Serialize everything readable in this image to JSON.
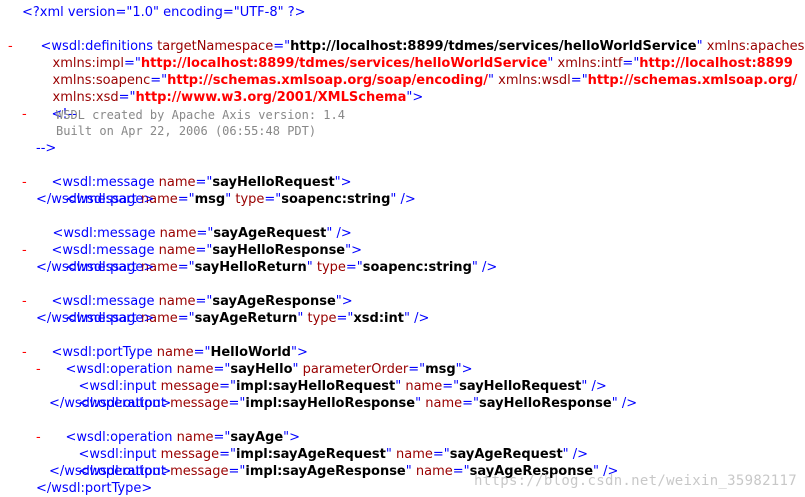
{
  "xml_decl": "<?xml version=\"1.0\" encoding=\"UTF-8\" ?>",
  "toggle_glyph": "-",
  "lines": {
    "l2": {
      "tag": "<wsdl:definitions ",
      "a1": "targetNamespace",
      "eq1": "=\"",
      "v1": "http://localhost:8899/tdmes/services/helloWorldService",
      "q1": "\"",
      "a2": " xmlns:apachesoap"
    },
    "l3": {
      "a1": "xmlns:impl",
      "eq1": "=\"",
      "v1": "http://localhost:8899/tdmes/services/helloWorldService",
      "q1": "\"",
      "a2": " xmlns:intf",
      "eq2": "=\"",
      "v2": "http://localhost:8899"
    },
    "l4": {
      "a1": "xmlns:soapenc",
      "eq1": "=\"",
      "v1": "http://schemas.xmlsoap.org/soap/encoding/",
      "q1": "\"",
      "a2": " xmlns:wsdl",
      "eq2": "=\"",
      "v2": "http://schemas.xmlsoap.org/"
    },
    "l5": {
      "a1": "xmlns:xsd",
      "eq1": "=\"",
      "v1": "http://www.w3.org/2001/XMLSchema",
      "close": "\">"
    },
    "l6": {
      "text": "<!--"
    },
    "l7": {
      "text": "WSDL created by Apache Axis version: 1.4"
    },
    "l8": {
      "text": "Built on Apr 22, 2006 (06:55:48 PDT)"
    },
    "l9": {
      "text": "-->"
    },
    "l10": {
      "open": "<wsdl:message ",
      "a1": "name",
      "eq": "=\"",
      "v1": "sayHelloRequest",
      "close": "\">"
    },
    "l11": {
      "open": "<wsdl:part ",
      "a1": "name",
      "eq1": "=\"",
      "v1": "msg",
      "q1": "\" ",
      "a2": "type",
      "eq2": "=\"",
      "v2": "soapenc:string",
      "close": "\" />"
    },
    "l12": {
      "text": "</wsdl:message>"
    },
    "l13": {
      "open": "<wsdl:message ",
      "a1": "name",
      "eq": "=\"",
      "v1": "sayAgeRequest",
      "close": "\" />"
    },
    "l14": {
      "open": "<wsdl:message ",
      "a1": "name",
      "eq": "=\"",
      "v1": "sayHelloResponse",
      "close": "\">"
    },
    "l15": {
      "open": "<wsdl:part ",
      "a1": "name",
      "eq1": "=\"",
      "v1": "sayHelloReturn",
      "q1": "\" ",
      "a2": "type",
      "eq2": "=\"",
      "v2": "soapenc:string",
      "close": "\" />"
    },
    "l16": {
      "text": "</wsdl:message>"
    },
    "l17": {
      "open": "<wsdl:message ",
      "a1": "name",
      "eq": "=\"",
      "v1": "sayAgeResponse",
      "close": "\">"
    },
    "l18": {
      "open": "<wsdl:part ",
      "a1": "name",
      "eq1": "=\"",
      "v1": "sayAgeReturn",
      "q1": "\" ",
      "a2": "type",
      "eq2": "=\"",
      "v2": "xsd:int",
      "close": "\" />"
    },
    "l19": {
      "text": "</wsdl:message>"
    },
    "l20": {
      "open": "<wsdl:portType ",
      "a1": "name",
      "eq": "=\"",
      "v1": "HelloWorld",
      "close": "\">"
    },
    "l21": {
      "open": "<wsdl:operation ",
      "a1": "name",
      "eq1": "=\"",
      "v1": "sayHello",
      "q1": "\" ",
      "a2": "parameterOrder",
      "eq2": "=\"",
      "v2": "msg",
      "close": "\">"
    },
    "l22": {
      "open": "<wsdl:input ",
      "a1": "message",
      "eq1": "=\"",
      "v1": "impl:sayHelloRequest",
      "q1": "\" ",
      "a2": "name",
      "eq2": "=\"",
      "v2": "sayHelloRequest",
      "close": "\" />"
    },
    "l23": {
      "open": "<wsdl:output ",
      "a1": "message",
      "eq1": "=\"",
      "v1": "impl:sayHelloResponse",
      "q1": "\" ",
      "a2": "name",
      "eq2": "=\"",
      "v2": "sayHelloResponse",
      "close": "\" />"
    },
    "l24": {
      "text": "</wsdl:operation>"
    },
    "l25": {
      "open": "<wsdl:operation ",
      "a1": "name",
      "eq": "=\"",
      "v1": "sayAge",
      "close": "\">"
    },
    "l26": {
      "open": "<wsdl:input ",
      "a1": "message",
      "eq1": "=\"",
      "v1": "impl:sayAgeRequest",
      "q1": "\" ",
      "a2": "name",
      "eq2": "=\"",
      "v2": "sayAgeRequest",
      "close": "\" />"
    },
    "l27": {
      "open": "<wsdl:output ",
      "a1": "message",
      "eq1": "=\"",
      "v1": "impl:sayAgeResponse",
      "q1": "\" ",
      "a2": "name",
      "eq2": "=\"",
      "v2": "sayAgeResponse",
      "close": "\" />"
    },
    "l28": {
      "text": "</wsdl:operation>"
    },
    "l29": {
      "text": "</wsdl:portType>"
    }
  },
  "watermark": "https://blog.csdn.net/weixin_35982117"
}
